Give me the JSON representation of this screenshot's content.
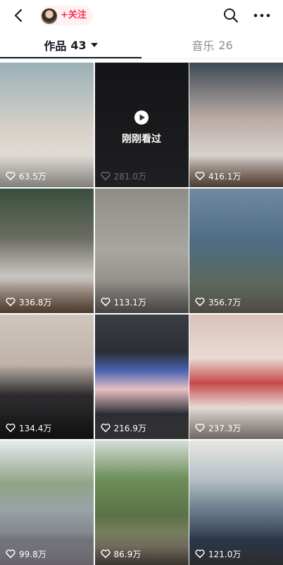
{
  "topbar": {
    "follow_label": "+关注",
    "icons": {
      "back": "chevron-left-icon",
      "search": "search-icon",
      "more": "more-dots-icon"
    }
  },
  "tabs": {
    "works_label": "作品",
    "works_count": "43",
    "music_label": "音乐",
    "music_count": "26"
  },
  "colors": {
    "accent": "#fe2c55",
    "tab_active": "#161823",
    "tab_inactive": "#8a8b91"
  },
  "videos": [
    {
      "likes": "63.5万"
    },
    {
      "likes": "281.0万",
      "overlay": "刚刚看过"
    },
    {
      "likes": "416.1万"
    },
    {
      "likes": "336.8万"
    },
    {
      "likes": "113.1万"
    },
    {
      "likes": "356.7万"
    },
    {
      "likes": "134.4万"
    },
    {
      "likes": "216.9万"
    },
    {
      "likes": "237.3万"
    },
    {
      "likes": "99.8万"
    },
    {
      "likes": "86.9万"
    },
    {
      "likes": "121.0万"
    }
  ]
}
